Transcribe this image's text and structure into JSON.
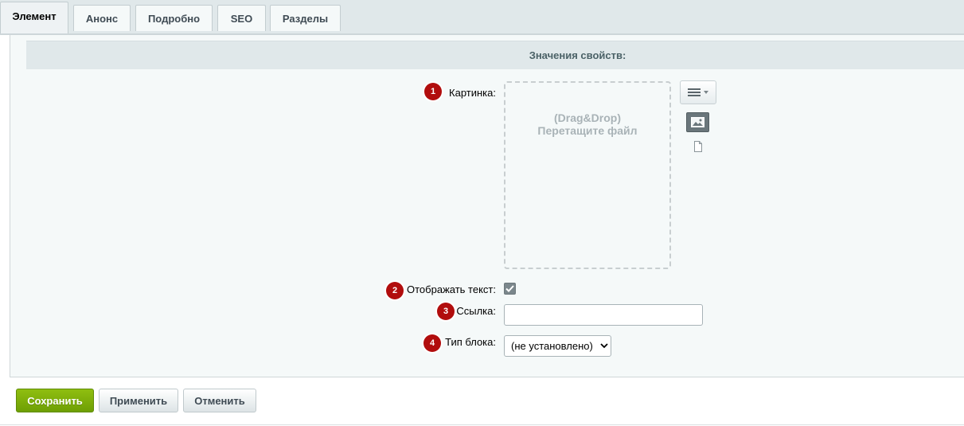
{
  "tabs": [
    {
      "label": "Элемент",
      "active": true
    },
    {
      "label": "Анонс",
      "active": false
    },
    {
      "label": "Подробно",
      "active": false
    },
    {
      "label": "SEO",
      "active": false
    },
    {
      "label": "Разделы",
      "active": false
    }
  ],
  "section": {
    "title": "Значения свойств:"
  },
  "fields": {
    "picture": {
      "marker": "1",
      "label": "Картинка:",
      "drop_line1": "(Drag&Drop)",
      "drop_line2": "Перетащите файл"
    },
    "show_text": {
      "marker": "2",
      "label": "Отображать текст:",
      "checked": true
    },
    "link": {
      "marker": "3",
      "label": "Ссылка:",
      "value": ""
    },
    "block_type": {
      "marker": "4",
      "label": "Тип блока:",
      "selected": "(не установлено)"
    }
  },
  "icons": {
    "menu": "hamburger-menu-icon",
    "image": "image-icon",
    "file": "file-icon",
    "check": "checkmark-icon",
    "dropdown": "chevron-down-icon"
  },
  "footer": {
    "save_label": "Сохранить",
    "apply_label": "Применить",
    "cancel_label": "Отменить"
  },
  "colors": {
    "marker": "#b10d0d",
    "save": "#7aaa08",
    "panel": "#f5f9f9",
    "header": "#e0e8ea"
  }
}
